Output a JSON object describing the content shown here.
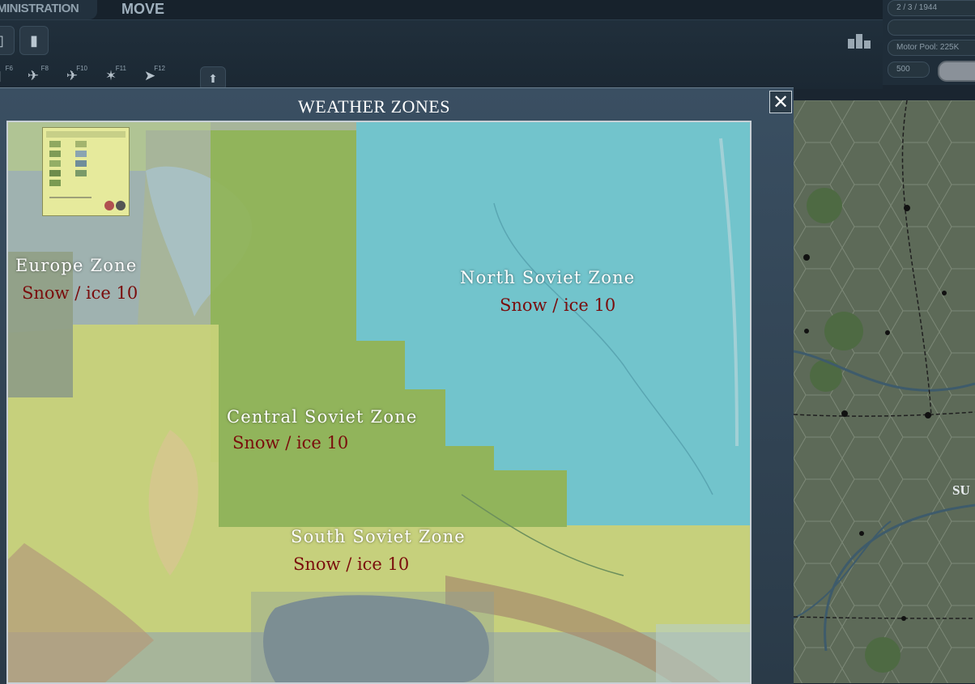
{
  "menu": {
    "admin_label": "MINISTRATION",
    "move_label": "MOVE"
  },
  "toolbar": {
    "hotkeys": [
      {
        "key": "F6",
        "icon": "unit-icon"
      },
      {
        "key": "F8",
        "icon": "air-icon"
      },
      {
        "key": "F10",
        "icon": "air-recon-icon"
      },
      {
        "key": "F11",
        "icon": "explosion-icon"
      },
      {
        "key": "F12",
        "icon": "arrow-icon"
      }
    ]
  },
  "right_panel": {
    "date": "2 / 3 / 1944",
    "motor_pool": "Motor Pool:  225K",
    "value_box": "500"
  },
  "dialog": {
    "title": "WEATHER ZONES",
    "close_label": "✕"
  },
  "zones": [
    {
      "id": "europe",
      "name": "Europe Zone",
      "weather": "Snow / ice  10"
    },
    {
      "id": "north",
      "name": "North Soviet Zone",
      "weather": "Snow / ice  10"
    },
    {
      "id": "central",
      "name": "Central Soviet Zone",
      "weather": "Snow / ice  10"
    },
    {
      "id": "south",
      "name": "South Soviet Zone",
      "weather": "Snow / ice  10"
    }
  ],
  "map_labels": {
    "edge_text": "SU"
  },
  "colors": {
    "north_zone": "#6fc6cf",
    "central_zone": "#9cbd5a",
    "south_zone": "#c8d474",
    "europe_zone": "#b8c48a",
    "weather_text": "#7a0c0c"
  }
}
